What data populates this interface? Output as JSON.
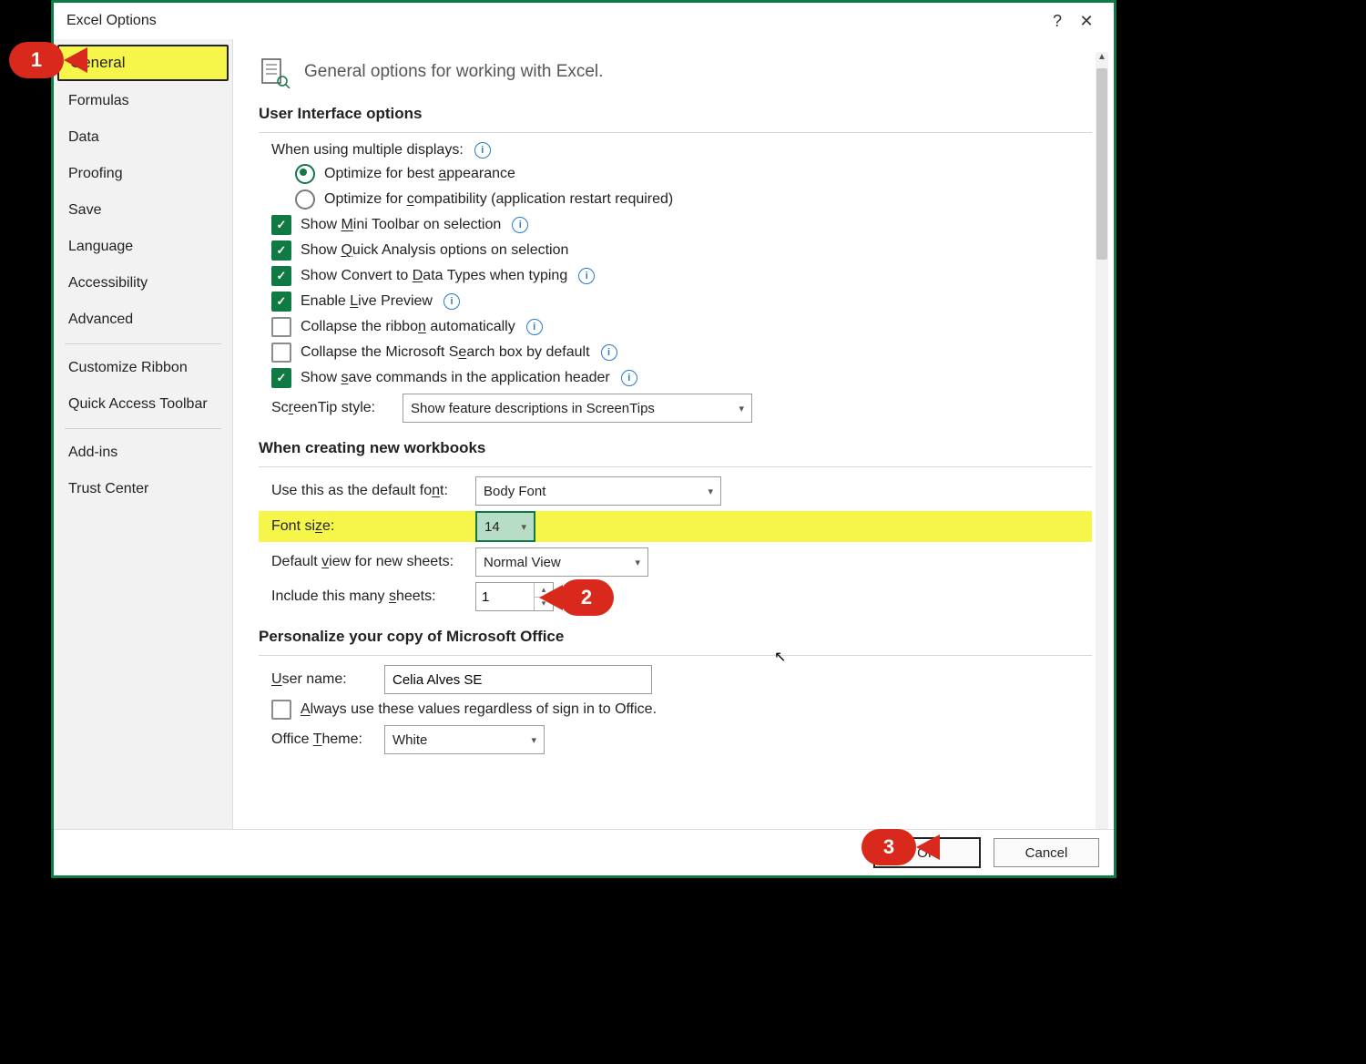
{
  "title": "Excel Options",
  "titlebar": {
    "help": "?",
    "close": "✕"
  },
  "sidebar": {
    "items": [
      {
        "label": "General",
        "selected": true
      },
      {
        "label": "Formulas"
      },
      {
        "label": "Data"
      },
      {
        "label": "Proofing"
      },
      {
        "label": "Save"
      },
      {
        "label": "Language"
      },
      {
        "label": "Accessibility"
      },
      {
        "label": "Advanced"
      }
    ],
    "group2": [
      {
        "label": "Customize Ribbon"
      },
      {
        "label": "Quick Access Toolbar"
      }
    ],
    "group3": [
      {
        "label": "Add-ins"
      },
      {
        "label": "Trust Center"
      }
    ]
  },
  "header_text": "General options for working with Excel.",
  "sec_ui": {
    "title": "User Interface options",
    "multi_disp_label": "When using multiple displays:",
    "radio_best_pre": "Optimize for best ",
    "radio_best_u": "a",
    "radio_best_post": "ppearance",
    "radio_compat_pre": "Optimize for ",
    "radio_compat_u": "c",
    "radio_compat_post": "ompatibility (application restart required)",
    "chk_mini_pre": "Show ",
    "chk_mini_u": "M",
    "chk_mini_post": "ini Toolbar on selection",
    "chk_quick_pre": "Show ",
    "chk_quick_u": "Q",
    "chk_quick_post": "uick Analysis options on selection",
    "chk_convert_pre": "Show Convert to ",
    "chk_convert_u": "D",
    "chk_convert_post": "ata Types when typing",
    "chk_live_pre": "Enable ",
    "chk_live_u": "L",
    "chk_live_post": "ive Preview",
    "chk_collapse_pre": "Collapse the ribbo",
    "chk_collapse_u": "n",
    "chk_collapse_post": " automatically",
    "chk_search_pre": "Collapse the Microsoft S",
    "chk_search_u": "e",
    "chk_search_post": "arch box by default",
    "chk_save_pre": "Show ",
    "chk_save_u": "s",
    "chk_save_post": "ave commands in the application header",
    "screentip_label_pre": "Sc",
    "screentip_label_u": "r",
    "screentip_label_post": "eenTip style:",
    "screentip_value": "Show feature descriptions in ScreenTips"
  },
  "sec_wb": {
    "title": "When creating new workbooks",
    "font_label_pre": "Use this as the default fo",
    "font_label_u": "n",
    "font_label_post": "t:",
    "font_value": "Body Font",
    "size_label_pre": "Font si",
    "size_label_u": "z",
    "size_label_post": "e:",
    "size_value": "14",
    "view_label_pre": "Default ",
    "view_label_u": "v",
    "view_label_post": "iew for new sheets:",
    "view_value": "Normal View",
    "sheets_label_pre": "Include this many ",
    "sheets_label_u": "s",
    "sheets_label_post": "heets:",
    "sheets_value": "1"
  },
  "sec_pers": {
    "title": "Personalize your copy of Microsoft Office",
    "user_label_u": "U",
    "user_label_post": "ser name:",
    "user_value": "Celia Alves SE",
    "always_u": "A",
    "always_post": "lways use these values regardless of sign in to Office.",
    "theme_label_pre": "Office ",
    "theme_label_u": "T",
    "theme_label_post": "heme:",
    "theme_value": "White"
  },
  "footer": {
    "ok": "OK",
    "cancel": "Cancel"
  },
  "badges": {
    "b1": "1",
    "b2": "2",
    "b3": "3"
  }
}
